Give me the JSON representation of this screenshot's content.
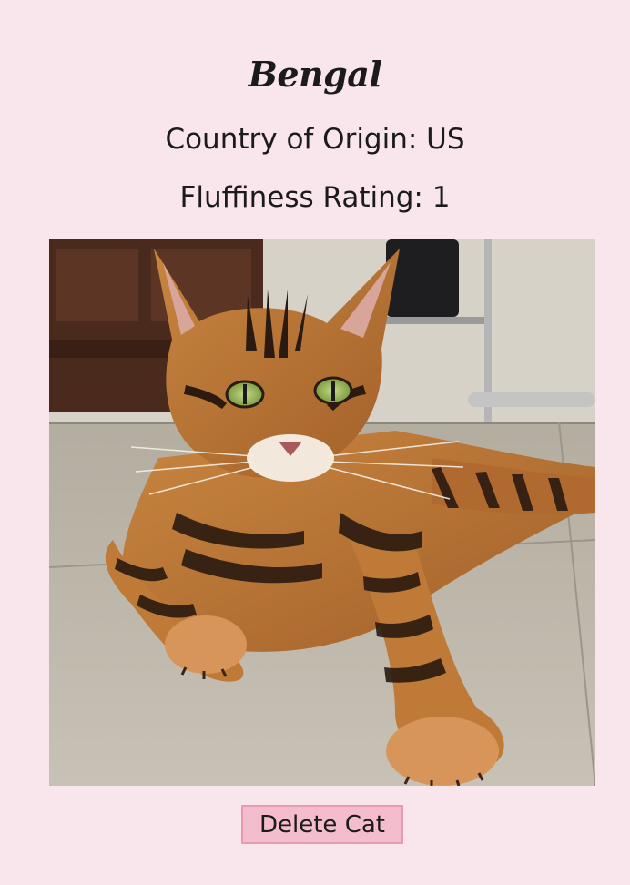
{
  "cat": {
    "name": "Bengal",
    "origin_text": "Country of Origin: US",
    "fluffiness_text": "Fluffiness Rating: 1"
  },
  "photo": {
    "subject": "bengal-cat-photo"
  },
  "actions": {
    "delete_label": "Delete Cat"
  },
  "colors": {
    "background": "#f9e5ec",
    "button_fill": "#f4bdcd",
    "button_border": "#e79bb2"
  }
}
